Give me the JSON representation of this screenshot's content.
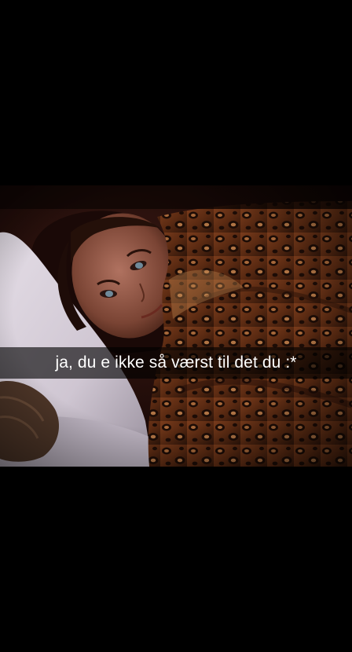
{
  "caption": {
    "text": "ja, du e ikke så værst til det du :*"
  },
  "colors": {
    "background": "#000000",
    "caption_bar": "rgba(0,0,0,0.62)",
    "caption_text": "#ffffff"
  }
}
